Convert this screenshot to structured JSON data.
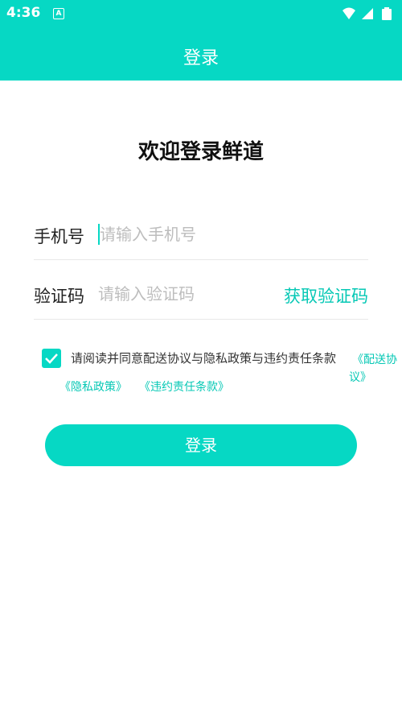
{
  "status_bar": {
    "time": "4:36",
    "notification_glyph": "A"
  },
  "app_bar": {
    "title": "登录"
  },
  "welcome": "欢迎登录鲜道",
  "phone": {
    "label": "手机号",
    "placeholder": "请输入手机号",
    "value": ""
  },
  "code": {
    "label": "验证码",
    "placeholder": "请输入验证码",
    "value": "",
    "get_code": "获取验证码"
  },
  "agreement": {
    "checked": true,
    "text": "请阅读并同意配送协议与隐私政策与违约责任条款",
    "delivery_link_line1": "《配送协",
    "delivery_link_line2": "议》",
    "privacy_link": "《隐私政策》",
    "breach_link": "《违约责任条款》"
  },
  "login_button": "登录",
  "colors": {
    "accent": "#06d8c4",
    "link": "#06c8b5"
  },
  "icons": [
    "wifi-icon",
    "signal-icon",
    "battery-icon",
    "check-icon"
  ]
}
